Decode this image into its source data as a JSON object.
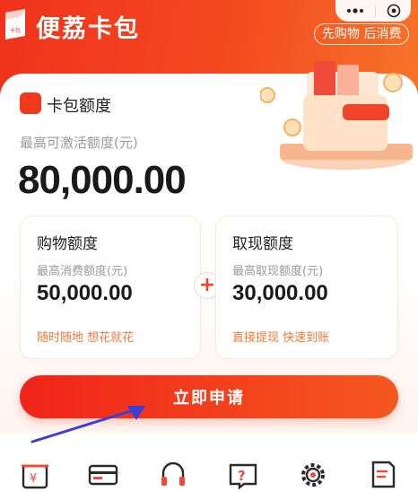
{
  "header": {
    "app_title": "便荔卡包",
    "slogan": "先购物 后消费",
    "logo_text": "卡包"
  },
  "card": {
    "title": "卡包额度",
    "max_label": "最高可激活额度(元)",
    "max_amount": "80,000.00"
  },
  "shopping": {
    "title": "购物额度",
    "label": "最高消费额度(元)",
    "amount": "50,000.00",
    "tag": "随时随地 想花就花"
  },
  "cash": {
    "title": "取现额度",
    "label": "最高取现额度(元)",
    "amount": "30,000.00",
    "tag": "直接提现 快速到账"
  },
  "plus_symbol": "+",
  "apply_button": "立即申请",
  "bottom_nav": [
    {
      "icon": "yuan-bag-icon"
    },
    {
      "icon": "card-icon"
    },
    {
      "icon": "headset-icon"
    },
    {
      "icon": "question-book-icon"
    },
    {
      "icon": "settings-gear-icon"
    },
    {
      "icon": "document-edit-icon"
    }
  ],
  "colors": {
    "primary": "#f0321c",
    "accent": "#f07a3c",
    "arrow": "#3a3fd6"
  }
}
